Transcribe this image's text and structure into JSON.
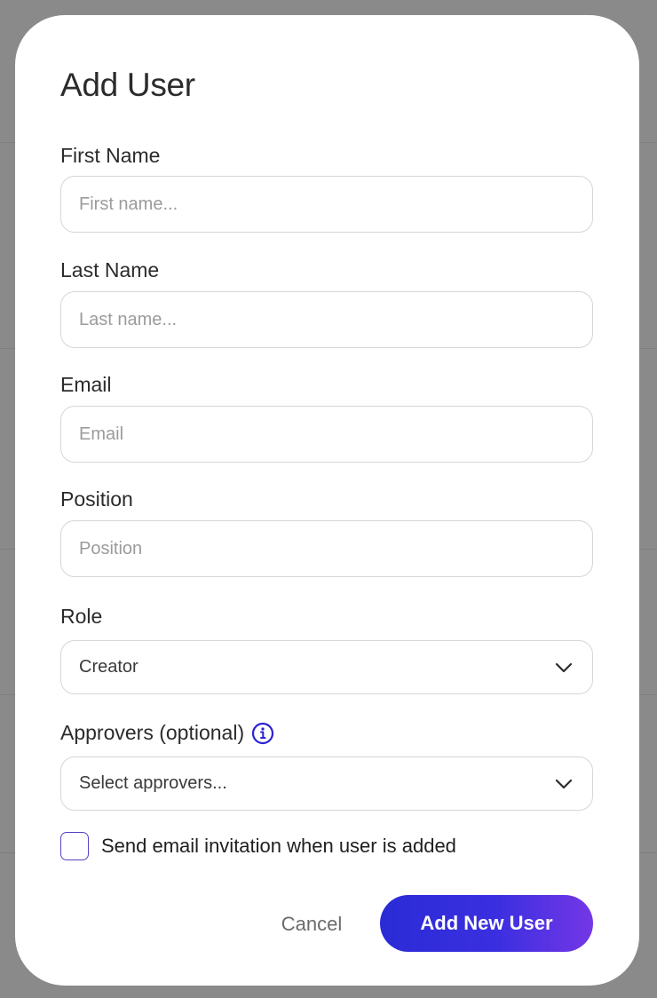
{
  "modal": {
    "title": "Add User",
    "fields": {
      "first_name": {
        "label": "First Name",
        "placeholder": "First name...",
        "value": ""
      },
      "last_name": {
        "label": "Last Name",
        "placeholder": "Last name...",
        "value": ""
      },
      "email": {
        "label": "Email",
        "placeholder": "Email",
        "value": ""
      },
      "position": {
        "label": "Position",
        "placeholder": "Position",
        "value": ""
      },
      "role": {
        "label": "Role",
        "value": "Creator",
        "icon": "chevron-down-icon"
      },
      "approvers": {
        "label": "Approvers (optional)",
        "value": "Select approvers...",
        "info_icon": "info-icon",
        "icon": "chevron-down-icon"
      }
    },
    "send_invite": {
      "label": "Send email invitation when user is added",
      "checked": false
    },
    "cancel_label": "Cancel",
    "submit_label": "Add New User"
  },
  "colors": {
    "accent_start": "#2a2bd6",
    "accent_end": "#7437e6",
    "info_icon": "#2a22d4",
    "overlay": "#8a8a8a"
  }
}
